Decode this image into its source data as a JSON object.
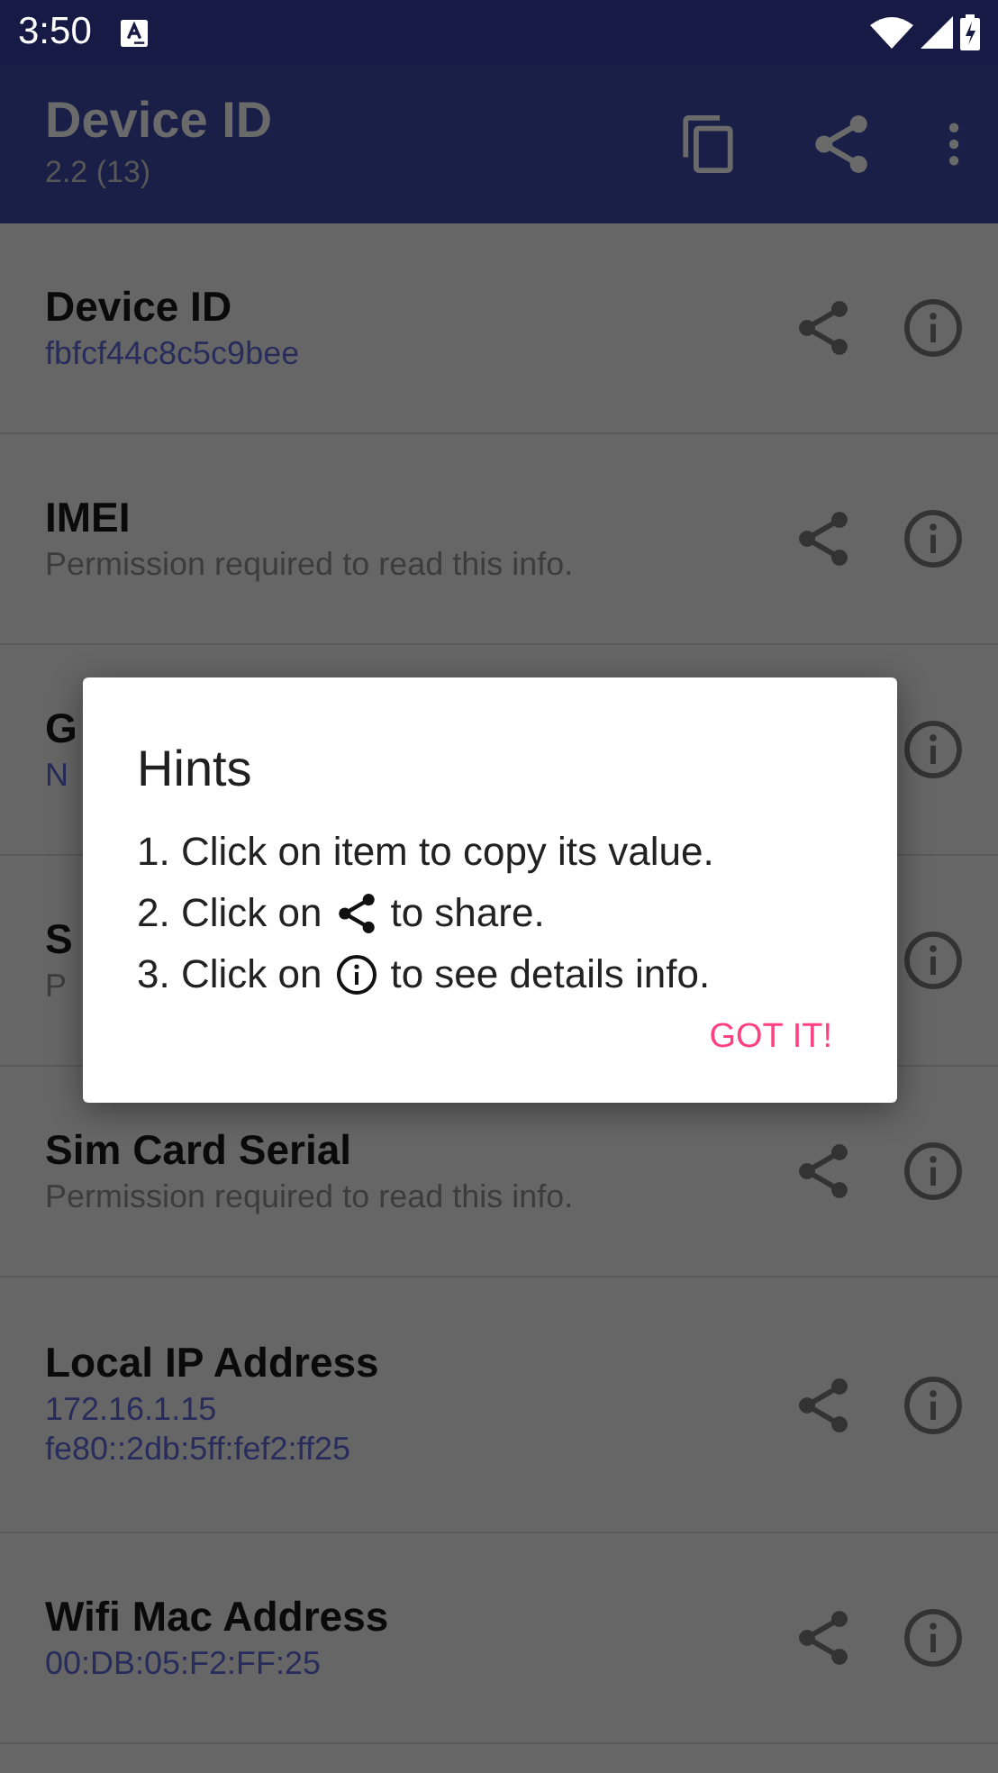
{
  "status_bar": {
    "time": "3:50"
  },
  "app_bar": {
    "title": "Device ID",
    "subtitle": "2.2 (13)"
  },
  "items": [
    {
      "title": "Device ID",
      "lines": [
        {
          "kind": "value",
          "text": "fbfcf44c8c5c9bee"
        }
      ]
    },
    {
      "title": "IMEI",
      "lines": [
        {
          "kind": "note",
          "text": "Permission required to read this info."
        }
      ]
    },
    {
      "title": "G",
      "lines": [
        {
          "kind": "value",
          "text": "N"
        }
      ]
    },
    {
      "title": "S",
      "lines": [
        {
          "kind": "note",
          "text": "P"
        }
      ]
    },
    {
      "title": "Sim Card Serial",
      "lines": [
        {
          "kind": "note",
          "text": "Permission required to read this info."
        }
      ]
    },
    {
      "title": "Local IP Address",
      "lines": [
        {
          "kind": "value",
          "text": "172.16.1.15"
        },
        {
          "kind": "value",
          "text": "fe80::2db:5ff:fef2:ff25"
        }
      ]
    },
    {
      "title": "Wifi Mac Address",
      "lines": [
        {
          "kind": "value",
          "text": "00:DB:05:F2:FF:25"
        }
      ]
    }
  ],
  "dialog": {
    "title": "Hints",
    "hints": [
      {
        "before": "1. Click on item to copy its value."
      },
      {
        "before": "2. Click on",
        "after": "to share."
      },
      {
        "before": "3. Click on",
        "after": "to see details info."
      }
    ],
    "button": "GOT IT!"
  }
}
